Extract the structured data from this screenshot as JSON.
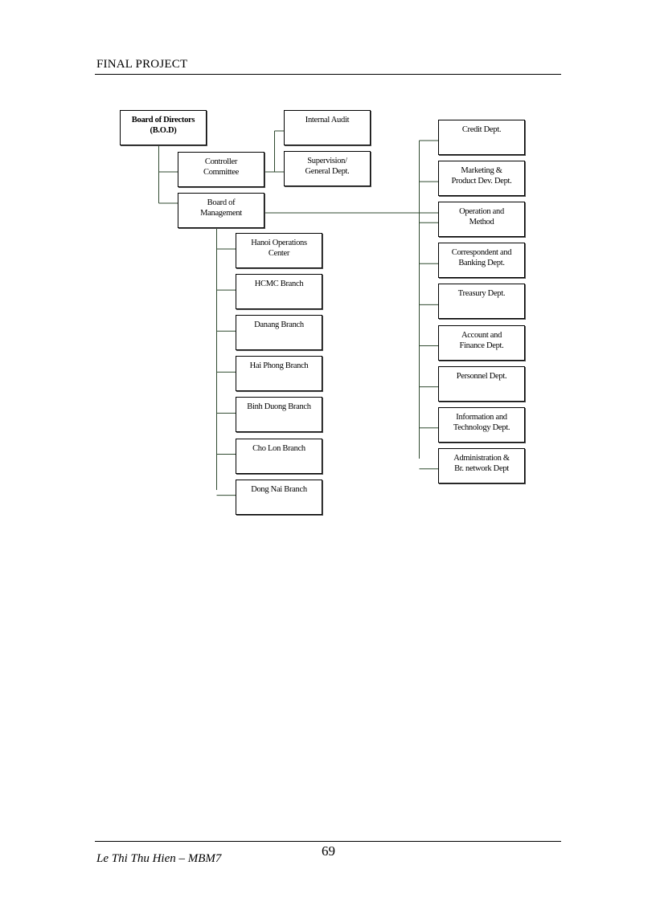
{
  "header": {
    "title": "FINAL PROJECT"
  },
  "chart": {
    "line_color": "#2f4a2f",
    "top": [
      {
        "id": "bod",
        "label": "Board of Directors\n(B.O.D)",
        "bold": true
      },
      {
        "id": "controller",
        "label": "Controller\nCommittee"
      },
      {
        "id": "bom",
        "label": "Board of\nManagement"
      },
      {
        "id": "audit",
        "label": "Internal Audit"
      },
      {
        "id": "supervision",
        "label": "Supervision/\nGeneral Dept."
      }
    ],
    "branches": [
      {
        "label": "Hanoi Operations\nCenter"
      },
      {
        "label": "HCMC Branch"
      },
      {
        "label": "Danang Branch"
      },
      {
        "label": "Hai Phong Branch"
      },
      {
        "label": "Binh Duong Branch"
      },
      {
        "label": "Cho Lon Branch"
      },
      {
        "label": "Dong Nai Branch"
      }
    ],
    "departments": [
      {
        "label": "Credit Dept."
      },
      {
        "label": "Marketing &\nProduct Dev. Dept."
      },
      {
        "label": "Operation and\nMethod"
      },
      {
        "label": "Correspondent and\nBanking Dept."
      },
      {
        "label": "Treasury Dept."
      },
      {
        "label": "Account and\nFinance Dept."
      },
      {
        "label": "Personnel Dept."
      },
      {
        "label": "Information and\nTechnology Dept."
      },
      {
        "label": "Administration &\nBr. network Dept"
      }
    ]
  },
  "footer": {
    "page_number": "69",
    "author": "Le Thi Thu Hien – MBM7"
  }
}
